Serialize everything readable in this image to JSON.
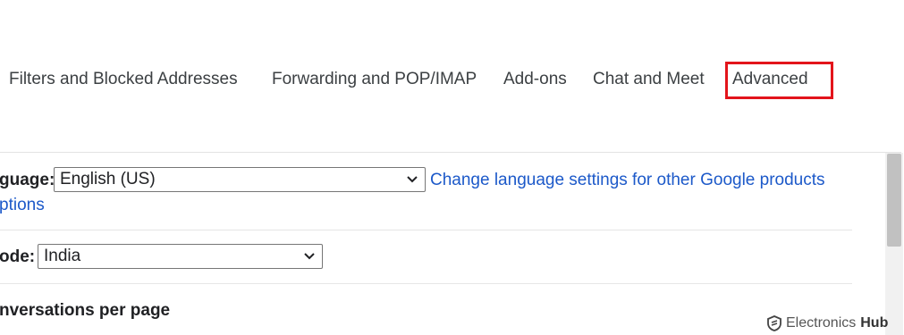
{
  "tabs": [
    {
      "label": "Filters and Blocked Addresses"
    },
    {
      "label": "Forwarding and POP/IMAP"
    },
    {
      "label": "Add-ons"
    },
    {
      "label": "Chat and Meet"
    },
    {
      "label": "Advanced"
    }
  ],
  "highlight_color": "#e3141b",
  "settings": {
    "language": {
      "label": "guage:",
      "value": "English (US)",
      "link": "Change language settings for other Google products",
      "link2": "ptions"
    },
    "country": {
      "label": "ode:",
      "value": "India"
    },
    "page_size": {
      "label": "nversations per page"
    }
  },
  "watermark": {
    "text1": "Electronics",
    "text2": "Hub",
    "icon": "shield-logo-icon"
  },
  "colors": {
    "link": "#1c59c9",
    "tab_text": "#3c4043"
  }
}
